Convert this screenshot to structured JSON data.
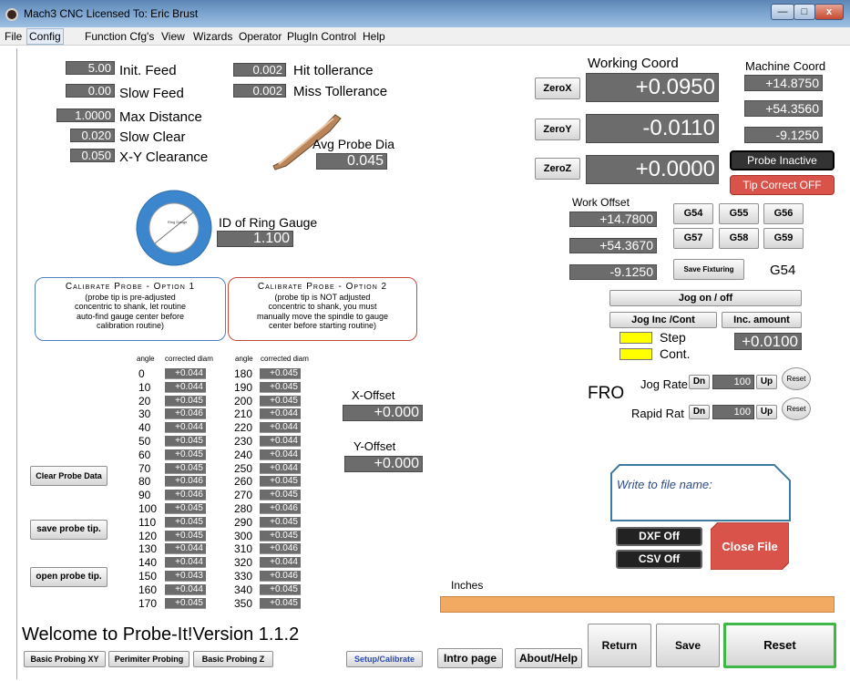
{
  "window": {
    "title": "Mach3 CNC  Licensed To: Eric Brust",
    "minimize": "—",
    "maximize": "□",
    "close": "x"
  },
  "menu": [
    "File",
    "Config",
    "Function Cfg's",
    "View",
    "Wizards",
    "Operator",
    "PlugIn Control",
    "Help"
  ],
  "params": {
    "init_feed": {
      "value": "5.00",
      "label": "Init. Feed"
    },
    "slow_feed": {
      "value": "0.00",
      "label": "Slow Feed"
    },
    "max_distance": {
      "value": "1.0000",
      "label": "Max Distance"
    },
    "slow_clear": {
      "value": "0.020",
      "label": "Slow Clear"
    },
    "xy_clearance": {
      "value": "0.050",
      "label": "X-Y Clearance"
    },
    "hit_tolerance": {
      "value": "0.002",
      "label": "Hit tollerance"
    },
    "miss_tolerance": {
      "value": "0.002",
      "label": "Miss Tollerance"
    },
    "avg_probe_dia": {
      "value": "0.045",
      "label": "Avg Probe Dia"
    },
    "ring_gauge": {
      "value": "1.100",
      "label": "ID of Ring Gauge"
    }
  },
  "calibrate1": {
    "title": "Calibrate Probe - Option 1",
    "text": [
      "(probe tip is pre-adjusted",
      "concentric to shank, let routine",
      "auto-find gauge center before",
      "calibration routine)"
    ]
  },
  "calibrate2": {
    "title": "Calibrate Probe - Option 2",
    "text": [
      "(probe tip is NOT adjusted",
      "concentric to shank, you must",
      "manually move the spindle to gauge",
      "center before starting routine)"
    ]
  },
  "table": {
    "angle_header": "angle",
    "diam_header": "corrected diam",
    "col1": [
      [
        "0",
        "+0.044"
      ],
      [
        "10",
        "+0.044"
      ],
      [
        "20",
        "+0.045"
      ],
      [
        "30",
        "+0.046"
      ],
      [
        "40",
        "+0.044"
      ],
      [
        "50",
        "+0.045"
      ],
      [
        "60",
        "+0.045"
      ],
      [
        "70",
        "+0.045"
      ],
      [
        "80",
        "+0.046"
      ],
      [
        "90",
        "+0.046"
      ],
      [
        "100",
        "+0.045"
      ],
      [
        "110",
        "+0.045"
      ],
      [
        "120",
        "+0.045"
      ],
      [
        "130",
        "+0.044"
      ],
      [
        "140",
        "+0.044"
      ],
      [
        "150",
        "+0.043"
      ],
      [
        "160",
        "+0.044"
      ],
      [
        "170",
        "+0.045"
      ]
    ],
    "col2": [
      [
        "180",
        "+0.045"
      ],
      [
        "190",
        "+0.045"
      ],
      [
        "200",
        "+0.045"
      ],
      [
        "210",
        "+0.044"
      ],
      [
        "220",
        "+0.044"
      ],
      [
        "230",
        "+0.044"
      ],
      [
        "240",
        "+0.044"
      ],
      [
        "250",
        "+0.044"
      ],
      [
        "260",
        "+0.045"
      ],
      [
        "270",
        "+0.045"
      ],
      [
        "280",
        "+0.046"
      ],
      [
        "290",
        "+0.045"
      ],
      [
        "300",
        "+0.045"
      ],
      [
        "310",
        "+0.046"
      ],
      [
        "320",
        "+0.044"
      ],
      [
        "330",
        "+0.046"
      ],
      [
        "340",
        "+0.045"
      ],
      [
        "350",
        "+0.045"
      ]
    ]
  },
  "offsets": {
    "x_label": "X-Offset",
    "x_value": "+0.000",
    "y_label": "Y-Offset",
    "y_value": "+0.000"
  },
  "left_buttons": {
    "clear": "Clear Probe Data",
    "save": "save probe tip.",
    "open": "open probe tip."
  },
  "coords": {
    "working_title": "Working Coord",
    "machine_title": "Machine Coord",
    "zerox": "ZeroX",
    "zeroy": "ZeroY",
    "zeroz": "ZeroZ",
    "x": "+0.0950",
    "y": "-0.0110",
    "z": "+0.0000",
    "mx": "+14.8750",
    "my": "+54.3560",
    "mz": "-9.1250"
  },
  "status": {
    "probe": "Probe Inactive",
    "tip": "Tip Correct OFF"
  },
  "work_offset": {
    "title": "Work Offset",
    "x": "+14.7800",
    "y": "+54.3670",
    "z": "-9.1250"
  },
  "g_buttons": [
    "G54",
    "G55",
    "G56",
    "G57",
    "G58",
    "G59"
  ],
  "save_fixturing": "Save Fixturing",
  "current_g": "G54",
  "jog": {
    "on_off": "Jog on / off",
    "inc_cont": "Jog Inc /Cont",
    "inc_amount": "Inc. amount",
    "step": "Step",
    "cont": "Cont.",
    "amount": "+0.0100"
  },
  "fro": {
    "label": "FRO",
    "jog_rate": "Jog Rate",
    "rapid_rate": "Rapid Rat",
    "dn": "Dn",
    "up": "Up",
    "jog_value": "100",
    "rapid_value": "100",
    "reset": "Reset"
  },
  "file": {
    "placeholder": "Write to file name:",
    "dxf": "DXF Off",
    "csv": "CSV Off",
    "close": "Close File"
  },
  "units": "Inches",
  "welcome": "Welcome to Probe-It!Version 1.1.2",
  "bottom_tabs": [
    "Basic Probing XY",
    "Perimiter Probing",
    "Basic Probing Z",
    "Setup/Calibrate",
    "Intro page",
    "About/Help"
  ],
  "actions": {
    "return": "Return",
    "save": "Save",
    "reset": "Reset"
  },
  "ring_icon_text": "Ring Gauge",
  "colors": {
    "dro_bg": "#6c6c6c",
    "accent_red": "#d9534a",
    "orange_bar": "#f2a962",
    "yellow": "#ffff00",
    "blue_ring": "#2e7bc4"
  }
}
